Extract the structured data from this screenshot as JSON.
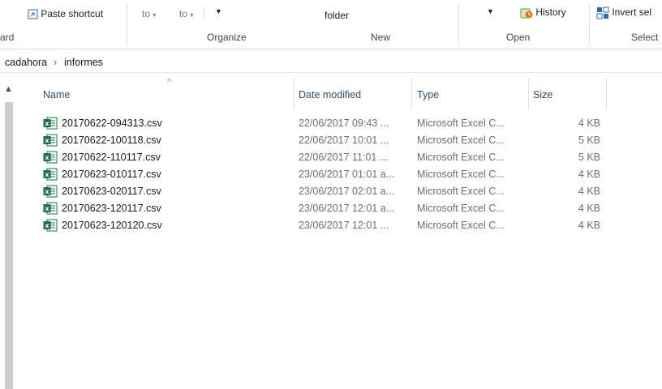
{
  "ribbon": {
    "paste_shortcut": "Paste shortcut",
    "to1": "to",
    "to2": "to",
    "folder": "folder",
    "history": "History",
    "invert_select": "Invert sel",
    "groups": {
      "clipboard": "ard",
      "organize": "Organize",
      "new": "New",
      "open": "Open",
      "select": "Select"
    }
  },
  "breadcrumb": {
    "part1": "cadahora",
    "separator": "›",
    "part2": "informes"
  },
  "columns": {
    "name": "Name",
    "date": "Date modified",
    "type": "Type",
    "size": "Size"
  },
  "files": [
    {
      "name": "20170622-094313.csv",
      "date": "22/06/2017 09:43 ...",
      "type": "Microsoft Excel C...",
      "size": "4 KB"
    },
    {
      "name": "20170622-100118.csv",
      "date": "22/06/2017 10:01 ...",
      "type": "Microsoft Excel C...",
      "size": "5 KB"
    },
    {
      "name": "20170622-110117.csv",
      "date": "22/06/2017 11:01 ...",
      "type": "Microsoft Excel C...",
      "size": "5 KB"
    },
    {
      "name": "20170623-010117.csv",
      "date": "23/06/2017 01:01 a...",
      "type": "Microsoft Excel C...",
      "size": "4 KB"
    },
    {
      "name": "20170623-020117.csv",
      "date": "23/06/2017 02:01 a...",
      "type": "Microsoft Excel C...",
      "size": "4 KB"
    },
    {
      "name": "20170623-120117.csv",
      "date": "23/06/2017 12:01 a...",
      "type": "Microsoft Excel C...",
      "size": "4 KB"
    },
    {
      "name": "20170623-120120.csv",
      "date": "23/06/2017 12:01 ...",
      "type": "Microsoft Excel C...",
      "size": "4 KB"
    }
  ],
  "colors": {
    "excel_green": "#1d7044",
    "header_text": "#2b4c73",
    "history_orange": "#e07a1f",
    "link_blue": "#2b6cb0"
  }
}
